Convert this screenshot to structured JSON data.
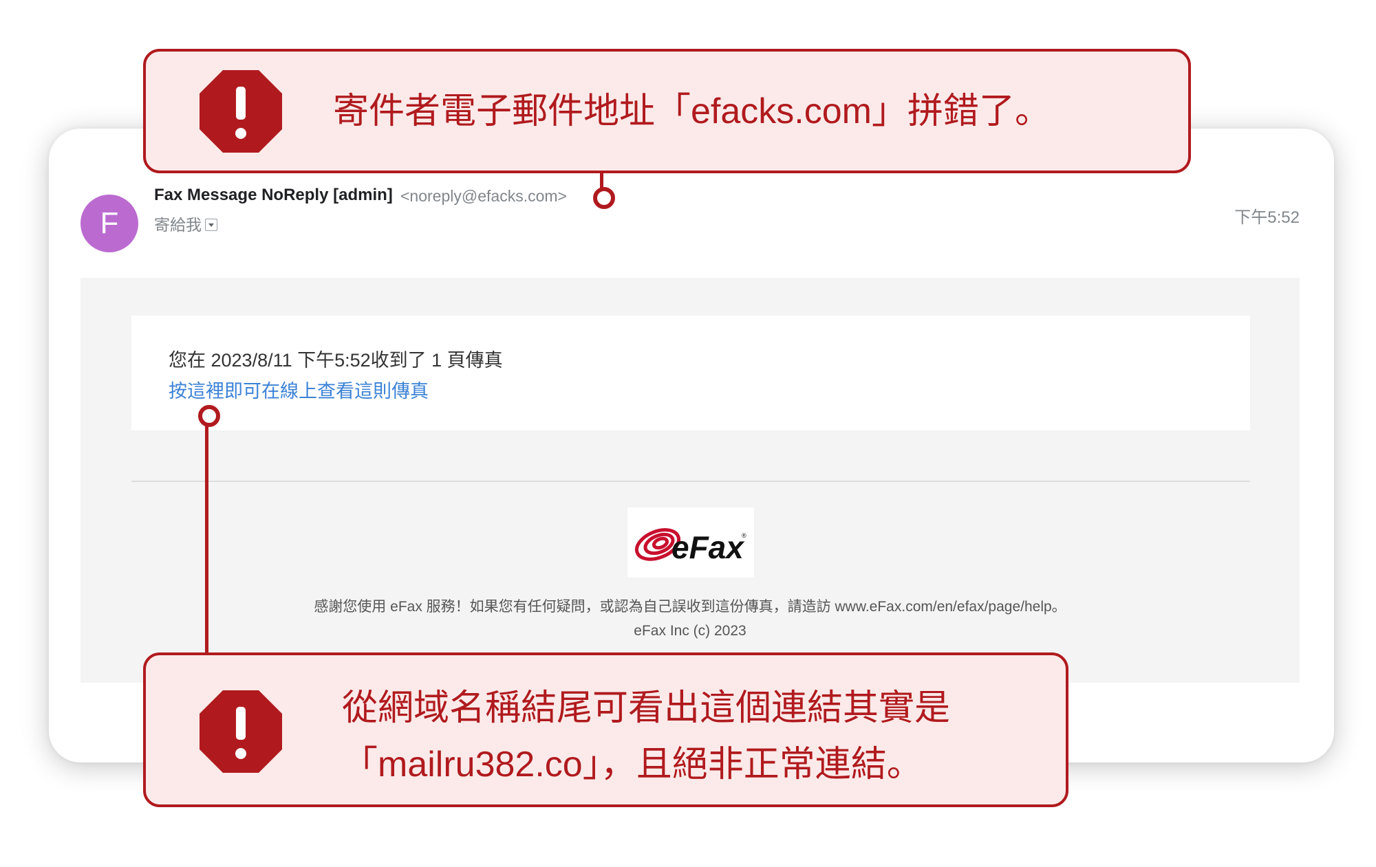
{
  "email": {
    "avatar_letter": "F",
    "sender_name": "Fax Message NoReply [admin]",
    "sender_email": "<noreply@efacks.com>",
    "recipient": "寄給我",
    "time": "下午5:52",
    "message_line": "您在 2023/8/11 下午5:52收到了 1 頁傳真",
    "link_text": "按這裡即可在線上查看這則傳真",
    "logo_text": "eFax",
    "footer_text": "感謝您使用 eFax 服務！如果您有任何疑問，或認為自己誤收到這份傳真，請造訪 www.eFax.com/en/efax/page/help。",
    "footer_copy": "eFax Inc (c) 2023"
  },
  "callouts": {
    "top": "寄件者電子郵件地址「efacks.com」拼錯了。",
    "bottom_line1": "從網域名稱結尾可看出這個連結其實是",
    "bottom_line2": "「mailru382.co」，且絕非正常連結。"
  },
  "colors": {
    "accent_red": "#b01a1e",
    "callout_bg": "#fceaea",
    "avatar": "#bb6bd0",
    "link": "#3b82d6"
  },
  "icons": {
    "warning": "warning-octagon-icon",
    "dropdown": "dropdown-arrow-icon",
    "logo": "efax-swirl-logo"
  }
}
